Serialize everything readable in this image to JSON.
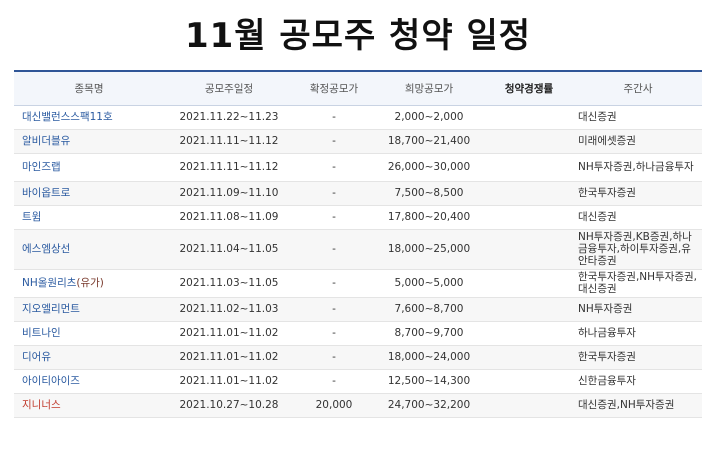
{
  "title": "11월 공모주 청약 일정",
  "headers": {
    "name": "종목명",
    "schedule": "공모주일정",
    "fixed_price": "확정공모가",
    "desired_price": "희망공모가",
    "competition": "청약경쟁률",
    "underwriter": "주간사"
  },
  "rows": [
    {
      "name": "대신밸런스스팩11호",
      "suffix": "",
      "schedule": "2021.11.22~11.23",
      "fixed": "-",
      "desired": "2,000~2,000",
      "competition": "",
      "underwriter": "대신증권"
    },
    {
      "name": "알비더블유",
      "suffix": "",
      "schedule": "2021.11.11~11.12",
      "fixed": "-",
      "desired": "18,700~21,400",
      "competition": "",
      "underwriter": "미래에셋증권"
    },
    {
      "name": "마인즈랩",
      "suffix": "",
      "schedule": "2021.11.11~11.12",
      "fixed": "-",
      "desired": "26,000~30,000",
      "competition": "",
      "underwriter": "NH투자증권,하나금융투자"
    },
    {
      "name": "바이옵트로",
      "suffix": "",
      "schedule": "2021.11.09~11.10",
      "fixed": "-",
      "desired": "7,500~8,500",
      "competition": "",
      "underwriter": "한국투자증권"
    },
    {
      "name": "트윔",
      "suffix": "",
      "schedule": "2021.11.08~11.09",
      "fixed": "-",
      "desired": "17,800~20,400",
      "competition": "",
      "underwriter": "대신증권"
    },
    {
      "name": "에스엠상선",
      "suffix": "",
      "schedule": "2021.11.04~11.05",
      "fixed": "-",
      "desired": "18,000~25,000",
      "competition": "",
      "underwriter": "NH투자증권,KB증권,하나금융투자,하이투자증권,유안타증권"
    },
    {
      "name": "NH올원리츠",
      "suffix": "(유가)",
      "schedule": "2021.11.03~11.05",
      "fixed": "-",
      "desired": "5,000~5,000",
      "competition": "",
      "underwriter": "한국투자증권,NH투자증권,대신증권"
    },
    {
      "name": "지오엘리먼트",
      "suffix": "",
      "schedule": "2021.11.02~11.03",
      "fixed": "-",
      "desired": "7,600~8,700",
      "competition": "",
      "underwriter": "NH투자증권"
    },
    {
      "name": "비트나인",
      "suffix": "",
      "schedule": "2021.11.01~11.02",
      "fixed": "-",
      "desired": "8,700~9,700",
      "competition": "",
      "underwriter": "하나금융투자"
    },
    {
      "name": "디어유",
      "suffix": "",
      "schedule": "2021.11.01~11.02",
      "fixed": "-",
      "desired": "18,000~24,000",
      "competition": "",
      "underwriter": "한국투자증권"
    },
    {
      "name": "아이티아이즈",
      "suffix": "",
      "schedule": "2021.11.01~11.02",
      "fixed": "-",
      "desired": "12,500~14,300",
      "competition": "",
      "underwriter": "신한금융투자"
    },
    {
      "name": "지니너스",
      "suffix": "",
      "schedule": "2021.10.27~10.28",
      "fixed": "20,000",
      "desired": "24,700~32,200",
      "competition": "",
      "underwriter": "대신증권,NH투자증권"
    }
  ]
}
